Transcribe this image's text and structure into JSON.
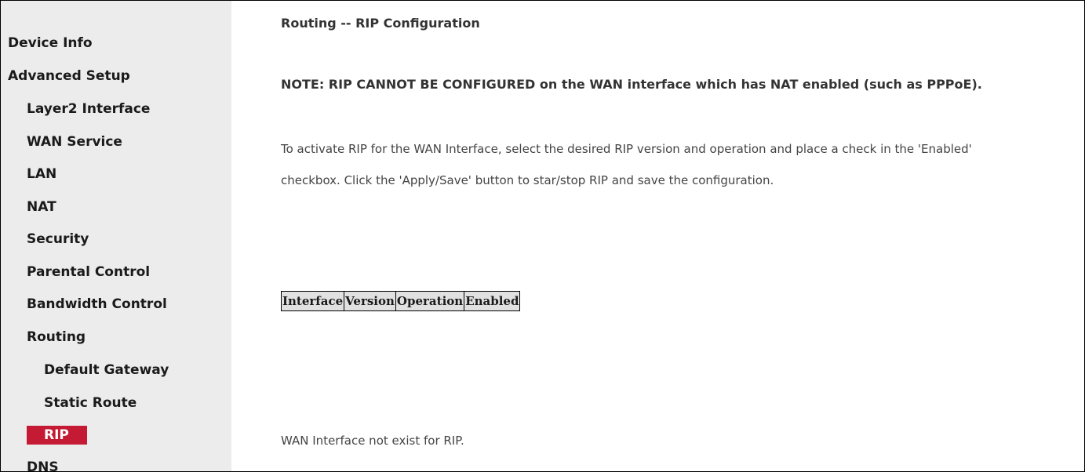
{
  "sidebar": {
    "items": [
      {
        "label": "Device Info",
        "level": 0
      },
      {
        "label": "Advanced Setup",
        "level": 0
      },
      {
        "label": "Layer2 Interface",
        "level": 1
      },
      {
        "label": "WAN Service",
        "level": 1
      },
      {
        "label": "LAN",
        "level": 1
      },
      {
        "label": "NAT",
        "level": 1
      },
      {
        "label": "Security",
        "level": 1
      },
      {
        "label": "Parental Control",
        "level": 1
      },
      {
        "label": "Bandwidth Control",
        "level": 1
      },
      {
        "label": "Routing",
        "level": 1
      },
      {
        "label": "Default Gateway",
        "level": 2
      },
      {
        "label": "Static Route",
        "level": 2
      },
      {
        "label": "RIP",
        "level": 2,
        "active": true
      },
      {
        "label": "DNS",
        "level": 1
      }
    ],
    "active_color": "#c41a33"
  },
  "main": {
    "title": "Routing -- RIP Configuration",
    "note": "NOTE: RIP CANNOT BE CONFIGURED on the WAN interface which has NAT enabled (such as PPPoE).",
    "description_line1": "To activate RIP for the WAN Interface, select the desired RIP version and operation and place a check in the 'Enabled'",
    "description_line2": "checkbox. Click the 'Apply/Save' button to star/stop RIP and save the configuration.",
    "table": {
      "headers": [
        "Interface",
        "Version",
        "Operation",
        "Enabled"
      ]
    },
    "empty_message": "WAN Interface not exist for RIP."
  }
}
